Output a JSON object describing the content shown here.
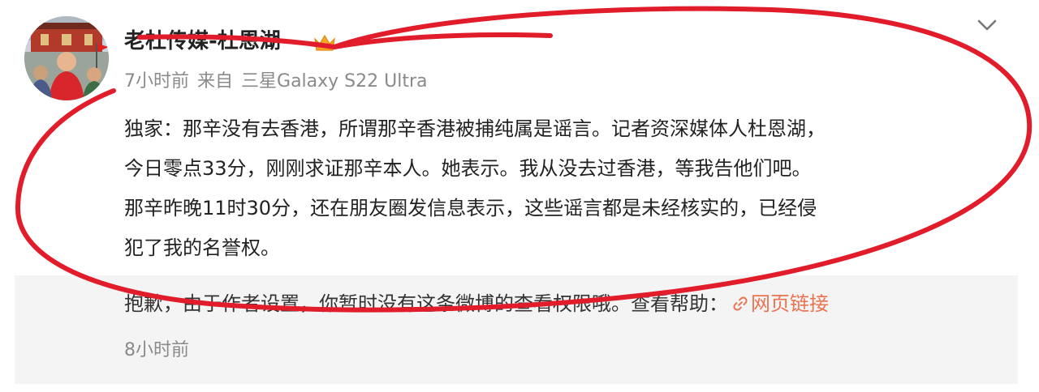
{
  "post": {
    "user_name": "老杜传媒-杜恩湖",
    "time": "7小时前",
    "source_prefix": "来自",
    "device": "三星Galaxy S22 Ultra",
    "text": "独家：那辛没有去香港，所谓那辛香港被捕纯属是谣言。记者资深媒体人杜恩湖，\n今日零点33分，刚刚求证那辛本人。她表示。我从没去过香港，等我告他们吧。\n那辛昨晚11时30分，还在朋友圈发信息表示，这些谣言都是未经核实的，已经侵\n犯了我的名誉权。",
    "icons": {
      "avatar": "avatar-photo",
      "badge": "vip-crown-icon",
      "menu": "chevron-down-icon"
    }
  },
  "repost": {
    "notice": "抱歉，由于作者设置，你暂时没有这条微博的查看权限哦。查看帮助：",
    "link_label": "网页链接",
    "link_icon": "link-icon",
    "time": "8小时前"
  },
  "colors": {
    "link": "#eb7350",
    "annotation": "#e11d2b",
    "repost_bg": "#f4f4f4"
  }
}
